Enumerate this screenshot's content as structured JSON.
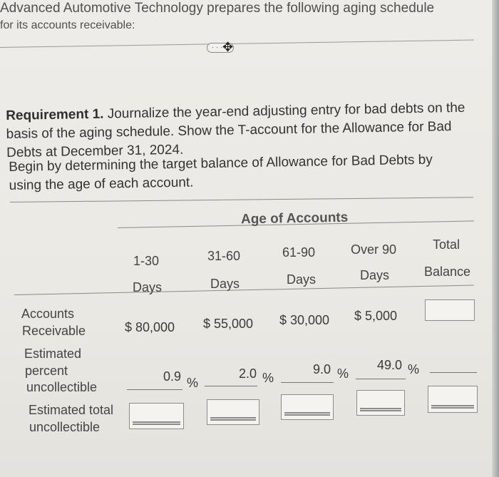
{
  "intro": {
    "line1": "Advanced Automotive Technology prepares the following aging schedule",
    "line2": "for its accounts receivable:"
  },
  "expand_button": {
    "label": "· · ·",
    "icon": "move-cursor-icon"
  },
  "requirement": {
    "label": "Requirement 1.",
    "text": " Journalize the year-end adjusting entry for bad debts on the basis of the aging schedule. Show the T-account for the Allowance for Bad Debts at December 31, 2024."
  },
  "instruction": "Begin by determining the target balance of Allowance for Bad Debts by using the age of each account.",
  "table": {
    "group_header": "Age of Accounts",
    "columns": [
      {
        "line1": "1-30",
        "line2": "Days"
      },
      {
        "line1": "31-60",
        "line2": "Days"
      },
      {
        "line1": "61-90",
        "line2": "Days"
      },
      {
        "line1": "Over 90",
        "line2": "Days"
      },
      {
        "line1": "Total",
        "line2": "Balance"
      }
    ],
    "rows": {
      "accounts_receivable": {
        "label_line1": "Accounts",
        "label_line2": "Receivable",
        "values": [
          "$ 80,000",
          "$ 55,000",
          "$ 30,000",
          "$ 5,000"
        ],
        "total_input": ""
      },
      "percent_uncollectible": {
        "label_line1": "Estimated",
        "label_line2": "percent",
        "label_line3": "uncollectible",
        "values": [
          "0.9",
          "2.0",
          "9.0",
          "49.0"
        ],
        "unit": "%",
        "total": ""
      },
      "total_uncollectible": {
        "label_line1": "Estimated total",
        "label_line2": "uncollectible",
        "inputs": [
          "",
          "",
          "",
          "",
          ""
        ]
      }
    }
  }
}
